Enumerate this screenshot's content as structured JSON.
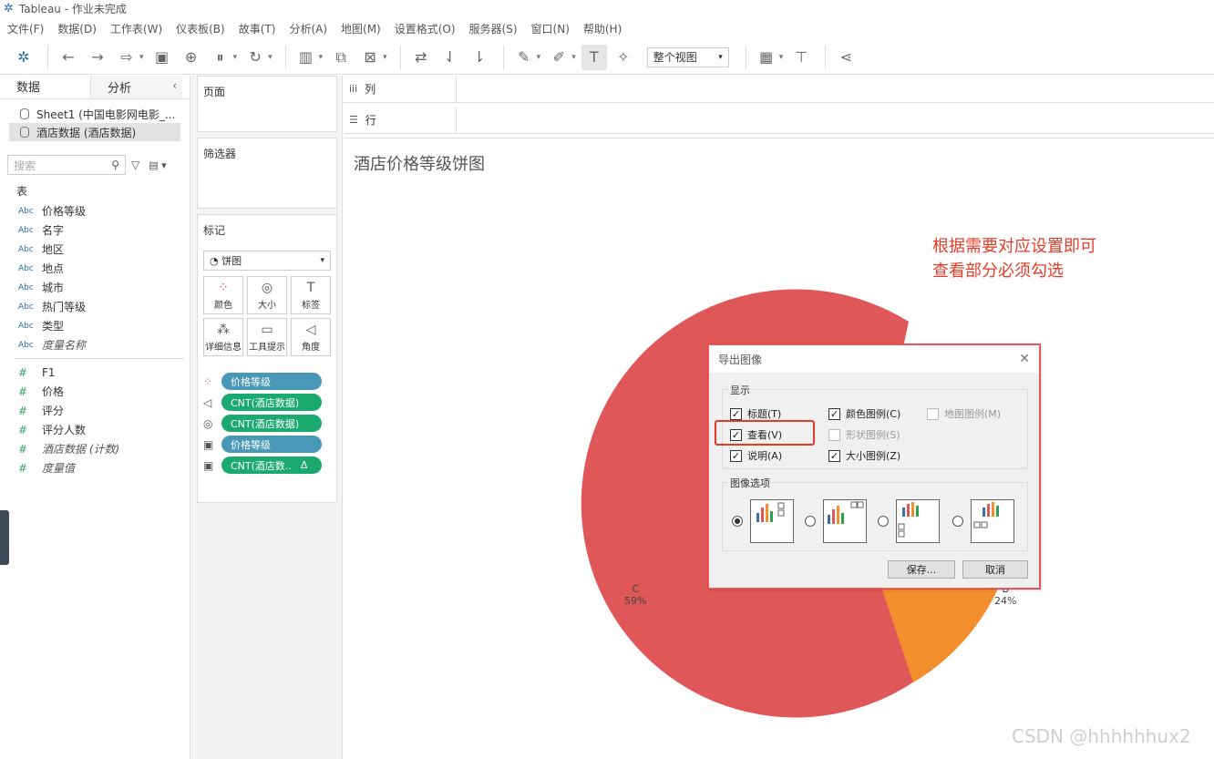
{
  "window": {
    "title": "Tableau - 作业未完成"
  },
  "menu": [
    "文件(F)",
    "数据(D)",
    "工作表(W)",
    "仪表板(B)",
    "故事(T)",
    "分析(A)",
    "地图(M)",
    "设置格式(O)",
    "服务器(S)",
    "窗口(N)",
    "帮助(H)"
  ],
  "toolbar": {
    "fit_label": "整个视图"
  },
  "left": {
    "tab_data": "数据",
    "tab_analysis": "分析",
    "sources": [
      "Sheet1 (中国电影网电影_...",
      "酒店数据 (酒店数据)"
    ],
    "search_placeholder": "搜索",
    "table_label": "表",
    "dimensions": [
      {
        "type": "Abc",
        "name": "价格等级"
      },
      {
        "type": "Abc",
        "name": "名字"
      },
      {
        "type": "Abc",
        "name": "地区"
      },
      {
        "type": "Abc",
        "name": "地点"
      },
      {
        "type": "Abc",
        "name": "城市"
      },
      {
        "type": "Abc",
        "name": "热门等级"
      },
      {
        "type": "Abc",
        "name": "类型"
      },
      {
        "type": "Abc",
        "name": "度量名称"
      }
    ],
    "measures": [
      {
        "type": "#",
        "name": "F1"
      },
      {
        "type": "#",
        "name": "价格"
      },
      {
        "type": "#",
        "name": "评分"
      },
      {
        "type": "#",
        "name": "评分人数"
      },
      {
        "type": "#",
        "name": "酒店数据 (计数)"
      },
      {
        "type": "#",
        "name": "度量值"
      }
    ]
  },
  "shelves": {
    "pages": "页面",
    "filters": "筛选器",
    "marks": "标记",
    "mark_type": "饼图",
    "mark_buttons": [
      "颜色",
      "大小",
      "标签",
      "详细信息",
      "工具提示",
      "角度"
    ],
    "pills": [
      "价格等级",
      "CNT(酒店数据)",
      "CNT(酒店数据)",
      "价格等级",
      "CNT(酒店数.."
    ],
    "columns": "列",
    "rows": "行"
  },
  "viz": {
    "title": "酒店价格等级饼图",
    "annotation_line1": "根据需要对应设置即可",
    "annotation_line2": "查看部分必须勾选",
    "label_c": "C",
    "label_c_pct": "59%",
    "label_b": "B",
    "label_b_pct": "24%",
    "colors": {
      "c": "#e05759",
      "b": "#f28e2b"
    }
  },
  "dialog": {
    "title": "导出图像",
    "display_group": "显示",
    "cb_title": "标题(T)",
    "cb_view": "查看(V)",
    "cb_caption": "说明(A)",
    "cb_color": "颜色图例(C)",
    "cb_shape": "形状图例(S)",
    "cb_size": "大小图例(Z)",
    "cb_map": "地图图例(M)",
    "options_group": "图像选项",
    "save": "保存...",
    "cancel": "取消"
  },
  "watermark": "CSDN @hhhhhhux2"
}
